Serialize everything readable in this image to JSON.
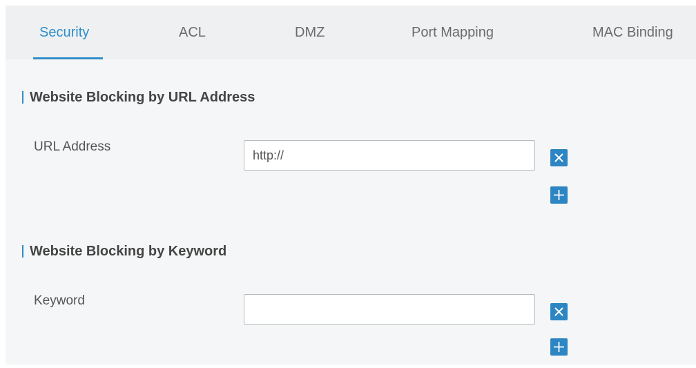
{
  "tabs": [
    {
      "label": "Security",
      "active": true
    },
    {
      "label": "ACL",
      "active": false
    },
    {
      "label": "DMZ",
      "active": false
    },
    {
      "label": "Port Mapping",
      "active": false
    },
    {
      "label": "MAC Binding",
      "active": false
    }
  ],
  "url_section": {
    "title": "Website Blocking by URL Address",
    "field_label": "URL Address",
    "input_value": "http://",
    "remove_icon": "close-icon",
    "add_icon": "plus-icon"
  },
  "keyword_section": {
    "title": "Website Blocking by Keyword",
    "field_label": "Keyword",
    "input_value": "",
    "remove_icon": "close-icon",
    "add_icon": "plus-icon"
  },
  "colors": {
    "accent": "#2f8ec9",
    "icon_button": "#2d86c3",
    "tabbar_bg": "#eef0f1",
    "page_bg": "#f5f6f7"
  }
}
